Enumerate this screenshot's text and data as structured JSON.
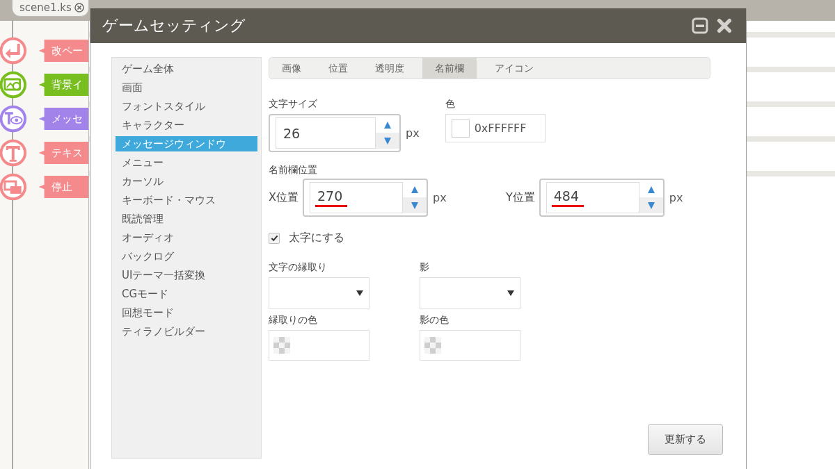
{
  "editor_tab": {
    "label": "scene1.ks"
  },
  "blocks": [
    {
      "kind": "return",
      "label": "改ペー",
      "color": "#f48a8c"
    },
    {
      "kind": "image",
      "label": "背景イ",
      "color": "#78be1e"
    },
    {
      "kind": "eye",
      "label": "メッセ",
      "color": "#a283ea"
    },
    {
      "kind": "text",
      "label": "テキス",
      "color": "#f48a8c"
    },
    {
      "kind": "windows",
      "label": "停止",
      "color": "#f48a8c"
    }
  ],
  "dialog": {
    "title": "ゲームセッティング",
    "menu": [
      {
        "label": "ゲーム全体",
        "selected": false
      },
      {
        "label": "画面",
        "selected": false
      },
      {
        "label": "フォントスタイル",
        "selected": false
      },
      {
        "label": "キャラクター",
        "selected": false
      },
      {
        "label": "メッセージウィンドウ",
        "selected": true
      },
      {
        "label": "メニュー",
        "selected": false
      },
      {
        "label": "カーソル",
        "selected": false
      },
      {
        "label": "キーボード・マウス",
        "selected": false
      },
      {
        "label": "既読管理",
        "selected": false
      },
      {
        "label": "オーディオ",
        "selected": false
      },
      {
        "label": "バックログ",
        "selected": false
      },
      {
        "label": "UIテーマ一括変換",
        "selected": false
      },
      {
        "label": "CGモード",
        "selected": false
      },
      {
        "label": "回想モード",
        "selected": false
      },
      {
        "label": "ティラノビルダー",
        "selected": false
      }
    ],
    "tabs": [
      {
        "label": "画像",
        "selected": false
      },
      {
        "label": "位置",
        "selected": false
      },
      {
        "label": "透明度",
        "selected": false
      },
      {
        "label": "名前欄",
        "selected": true
      },
      {
        "label": "アイコン",
        "selected": false
      }
    ],
    "font_size": {
      "label": "文字サイズ",
      "value": "26",
      "unit": "px",
      "underlined": false
    },
    "color": {
      "label": "色",
      "value": "0xFFFFFF"
    },
    "name_position": {
      "label": "名前欄位置",
      "x": {
        "label": "X位置",
        "value": "270",
        "unit": "px",
        "underlined": true
      },
      "y": {
        "label": "Y位置",
        "value": "484",
        "unit": "px",
        "underlined": true
      }
    },
    "bold": {
      "label": "太字にする",
      "checked": true
    },
    "outline": {
      "label": "文字の縁取り"
    },
    "shadow": {
      "label": "影"
    },
    "outline_color": {
      "label": "縁取りの色"
    },
    "shadow_color": {
      "label": "影の色"
    },
    "update_button": "更新する"
  }
}
